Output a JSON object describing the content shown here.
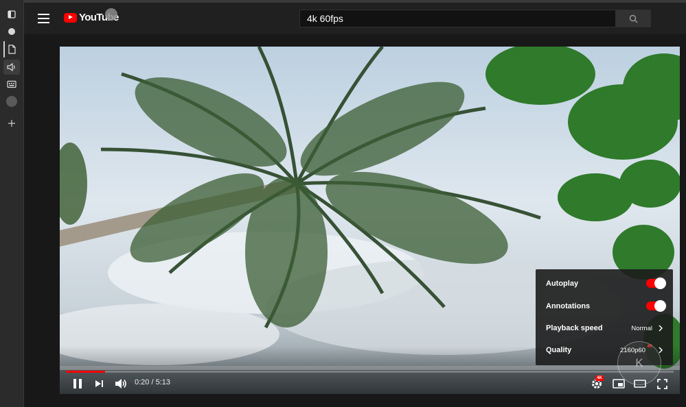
{
  "browser_sidebar": {
    "icons": [
      "sidebar-toggle-icon",
      "circle-icon",
      "document-icon",
      "speaker-icon",
      "keyboard-icon",
      "circle-icon",
      "plus-icon"
    ]
  },
  "header": {
    "logo_text": "YouTube",
    "search_value": "4k 60fps",
    "search_icon": "search-icon",
    "menu_icon": "hamburger-menu-icon"
  },
  "player": {
    "progress_fraction": 0.064,
    "time_current": "0:20",
    "time_total": "5:13",
    "time_display": "0:20 / 5:13",
    "settings_badge": "4K",
    "watermark_letter": "K",
    "colors": {
      "progress": "#ff0000",
      "toggle_on": "#ff0000"
    }
  },
  "settings_menu": {
    "autoplay_label": "Autoplay",
    "autoplay_on": true,
    "annotations_label": "Annotations",
    "annotations_on": true,
    "playback_speed_label": "Playback speed",
    "playback_speed_value": "Normal",
    "quality_label": "Quality",
    "quality_value": "2160p60",
    "quality_badge": "4K"
  }
}
